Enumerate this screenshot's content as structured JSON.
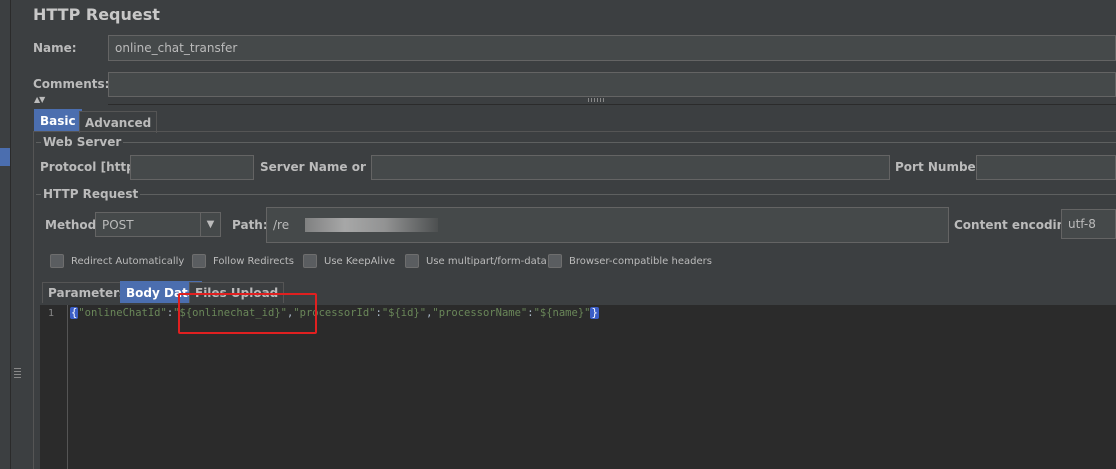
{
  "title": "HTTP Request",
  "name": {
    "label": "Name:",
    "value": "online_chat_transfer"
  },
  "comments": {
    "label": "Comments:",
    "value": ""
  },
  "tabs": [
    "Basic",
    "Advanced"
  ],
  "web_server": {
    "title": "Web Server",
    "protocol_label": "Protocol [http]:",
    "server_label": "Server Name or IP:",
    "port_label": "Port Number:"
  },
  "http_request": {
    "title": "HTTP Request",
    "method_label": "Method:",
    "method_value": "POST",
    "path_label": "Path:",
    "path_value": "/re",
    "encoding_label": "Content encoding:",
    "encoding_value": "utf-8"
  },
  "checkboxes": [
    "Redirect Automatically",
    "Follow Redirects",
    "Use KeepAlive",
    "Use multipart/form-data",
    "Browser-compatible headers"
  ],
  "sub_tabs": [
    "Parameters",
    "Body Data",
    "Files Upload"
  ],
  "editor": {
    "line_number": "1",
    "open_brace": "{",
    "key1": "\"onlineChatId\"",
    "colon": ":",
    "val1": "\"${onlinechat_id}\"",
    "comma": ",",
    "key2": "\"processorId\"",
    "val2": "\"${id}\"",
    "key3": "\"processorName\"",
    "val3": "\"${name}\"",
    "close_brace": "}"
  }
}
